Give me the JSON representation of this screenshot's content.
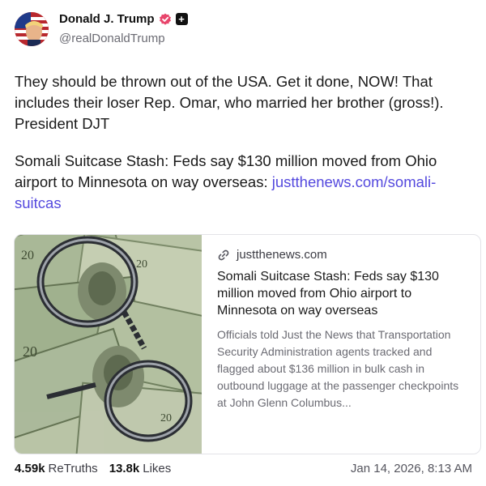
{
  "author": {
    "display_name": "Donald J. Trump",
    "handle": "@realDonaldTrump",
    "verified_icon": "verified-badge-icon",
    "extra_badge_icon": "plus-badge-icon",
    "extra_badge_glyph": "+"
  },
  "post": {
    "paragraph1": "They should be thrown out of the USA. Get it done, NOW! That includes their loser Rep. Omar, who married her brother (gross!). President DJT",
    "paragraph2_text": "Somali Suitcase Stash: Feds say $130 million moved from Ohio airport to Minnesota on way overseas: ",
    "paragraph2_link": "justthenews.com/somali-suitcas"
  },
  "card": {
    "image_icon": "handcuffs-on-money-image",
    "domain": "justthenews.com",
    "title": "Somali Suitcase Stash: Feds say $130 million moved from Ohio airport to Minnesota on way overseas",
    "description": "Officials told Just the News that Transportation Security Administration agents tracked and flagged about $136 million in bulk cash in outbound luggage at the passenger checkpoints at John Glenn Columbus..."
  },
  "stats": {
    "retruths_count": "4.59k",
    "retruths_label": "ReTruths",
    "likes_count": "13.8k",
    "likes_label": "Likes",
    "timestamp": "Jan 14, 2026, 8:13 AM"
  },
  "colors": {
    "link": "#5449de",
    "verified": "#e8456b",
    "muted": "#6b6b73"
  }
}
